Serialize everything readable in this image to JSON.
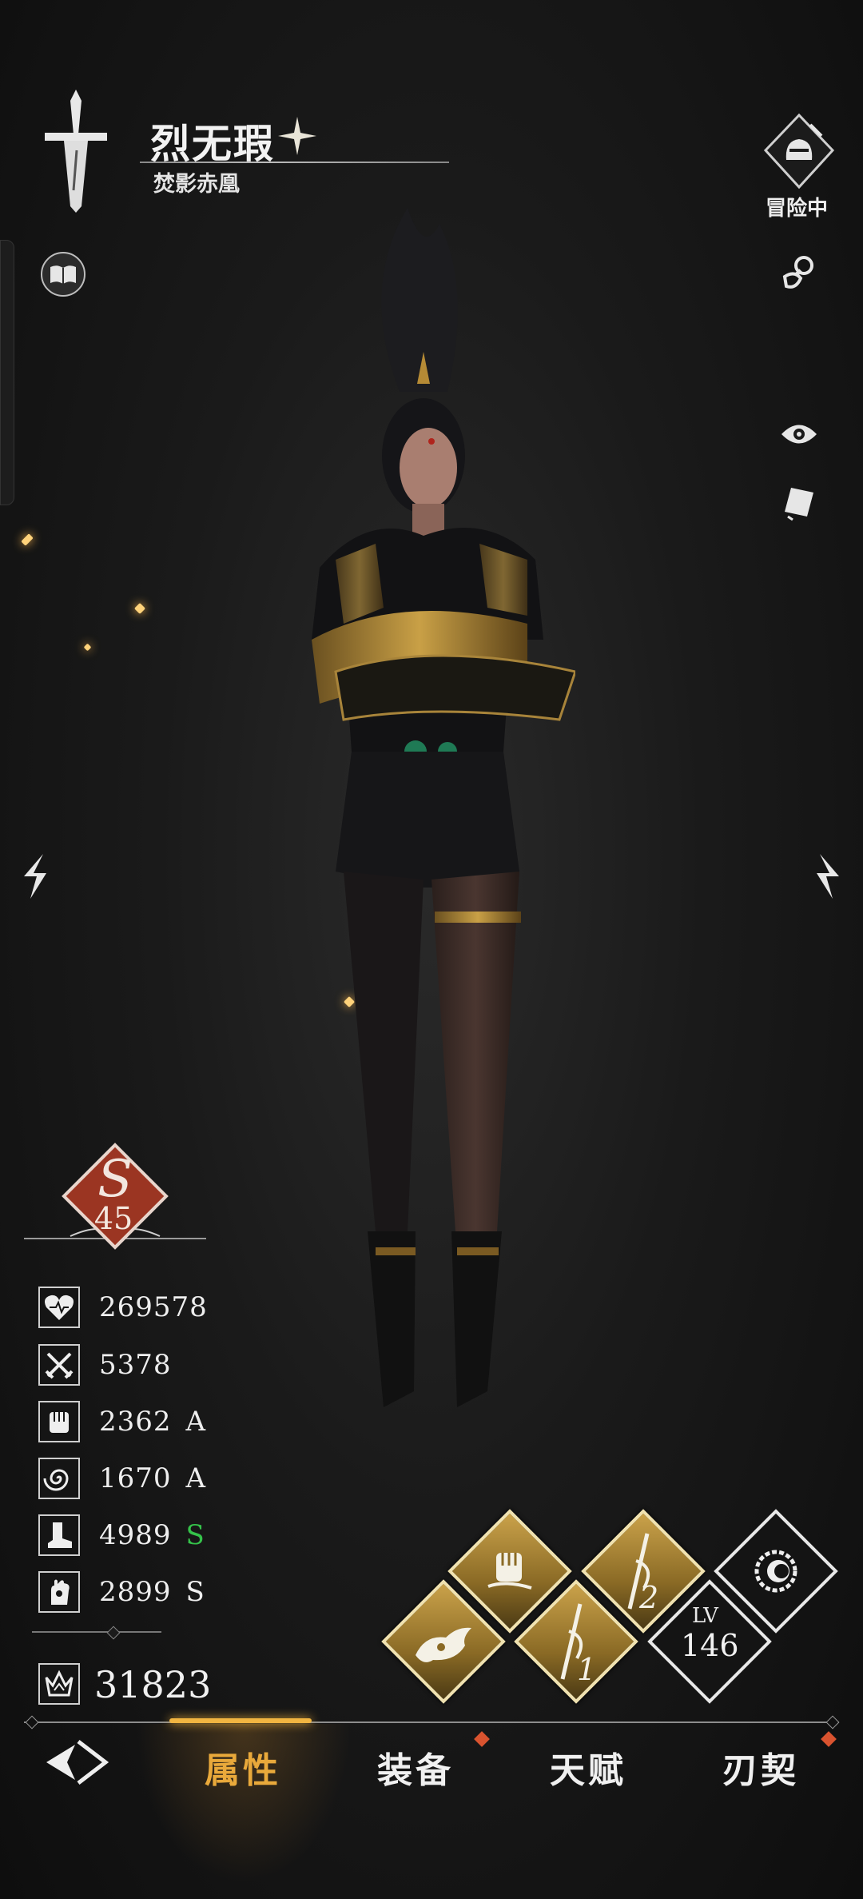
{
  "character": {
    "name": "烈无瑕",
    "title": "焚影赤凰",
    "status_label": "冒险中"
  },
  "rank": {
    "grade_letter": "S",
    "level": "45"
  },
  "stats": [
    {
      "icon": "heart-icon",
      "value": "269578",
      "grade": ""
    },
    {
      "icon": "swords-icon",
      "value": "5378",
      "grade": ""
    },
    {
      "icon": "fist-icon",
      "value": "2362",
      "grade": "A"
    },
    {
      "icon": "spiral-icon",
      "value": "1670",
      "grade": "A"
    },
    {
      "icon": "boot-icon",
      "value": "4989",
      "grade": "S"
    },
    {
      "icon": "hand-icon",
      "value": "2899",
      "grade": "S"
    }
  ],
  "power": {
    "value": "31823"
  },
  "skills": {
    "lv_label": "LV",
    "lv_value": "146",
    "weapon1_number": "1",
    "weapon2_number": "2"
  },
  "nav": {
    "tabs": [
      "属性",
      "装备",
      "天赋",
      "刃契"
    ],
    "active_index": 0
  },
  "colors": {
    "accent_gold": "#e9a93b",
    "grade_green": "#35c24a",
    "notification_red": "#d9532f",
    "rank_red": "#9b3522"
  }
}
